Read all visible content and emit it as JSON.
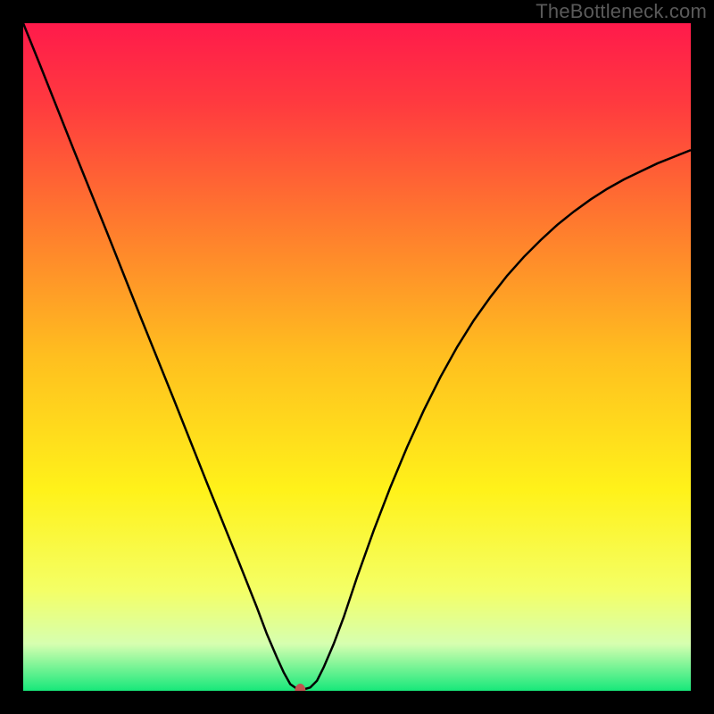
{
  "watermark": "TheBottleneck.com",
  "chart_data": {
    "type": "line",
    "title": "",
    "xlabel": "",
    "ylabel": "",
    "xlim": [
      0,
      100
    ],
    "ylim": [
      0,
      100
    ],
    "background_gradient": {
      "stops": [
        {
          "offset": 0.0,
          "color": "#ff1a4b"
        },
        {
          "offset": 0.12,
          "color": "#ff3a3f"
        },
        {
          "offset": 0.3,
          "color": "#ff7a2e"
        },
        {
          "offset": 0.5,
          "color": "#ffbf1f"
        },
        {
          "offset": 0.7,
          "color": "#fff21a"
        },
        {
          "offset": 0.85,
          "color": "#f4ff66"
        },
        {
          "offset": 0.93,
          "color": "#d6ffb0"
        },
        {
          "offset": 1.0,
          "color": "#17e87a"
        }
      ]
    },
    "series": [
      {
        "name": "bottleneck-curve",
        "color": "#000000",
        "x": [
          0.0,
          2.5,
          5.0,
          7.5,
          10.0,
          12.5,
          15.0,
          17.5,
          20.0,
          22.5,
          25.0,
          27.5,
          30.0,
          32.5,
          35.0,
          36.5,
          38.0,
          39.0,
          40.0,
          41.0,
          42.0,
          43.0,
          44.0,
          45.0,
          46.5,
          48.0,
          50.0,
          52.5,
          55.0,
          57.5,
          60.0,
          62.5,
          65.0,
          67.5,
          70.0,
          72.5,
          75.0,
          77.5,
          80.0,
          82.5,
          85.0,
          87.5,
          90.0,
          92.5,
          95.0,
          97.5,
          100.0
        ],
        "y": [
          100.0,
          93.8,
          87.5,
          81.2,
          75.0,
          68.8,
          62.5,
          56.2,
          50.0,
          43.8,
          37.5,
          31.2,
          25.0,
          18.8,
          12.5,
          8.5,
          5.0,
          2.8,
          1.0,
          0.3,
          0.2,
          0.5,
          1.5,
          3.5,
          7.0,
          11.0,
          17.0,
          24.0,
          30.5,
          36.5,
          42.0,
          47.0,
          51.5,
          55.5,
          59.0,
          62.2,
          65.0,
          67.5,
          69.8,
          71.8,
          73.6,
          75.2,
          76.6,
          77.8,
          79.0,
          80.0,
          81.0
        ]
      }
    ],
    "marker": {
      "x": 41.5,
      "y": 0.0,
      "color": "#c2524f",
      "rx": 6,
      "ry": 8
    }
  }
}
